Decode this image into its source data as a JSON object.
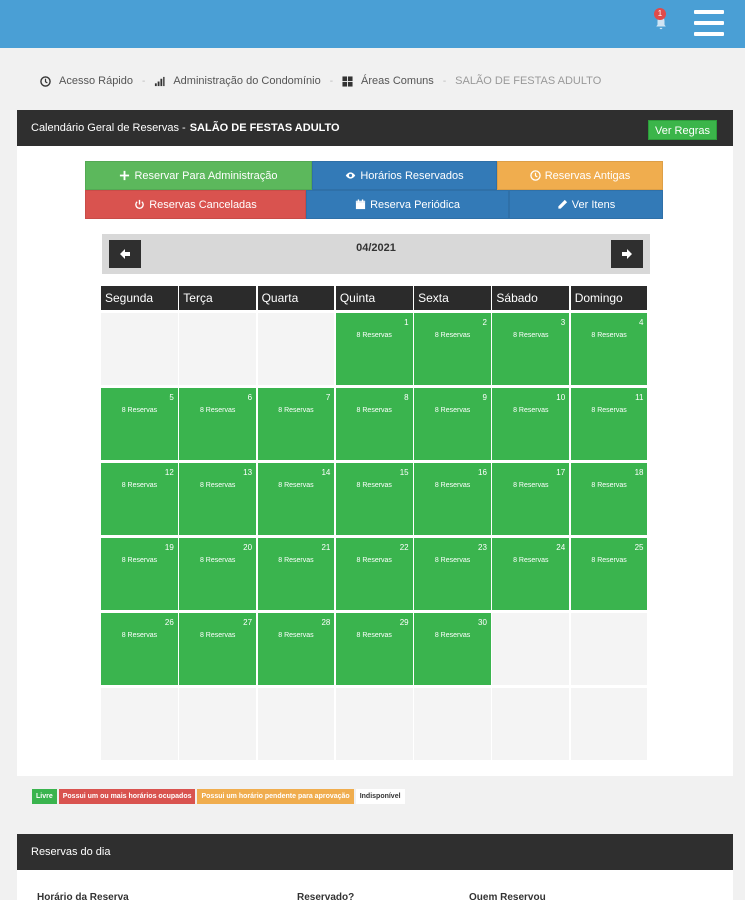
{
  "header": {
    "notification_count": "1",
    "bar_color": "#4a9fd5"
  },
  "breadcrumb": [
    {
      "icon": "clock-icon",
      "label": "Acesso Rápido"
    },
    {
      "icon": "chart-icon",
      "label": "Administração do Condomínio"
    },
    {
      "icon": "grid-icon",
      "label": "Áreas Comuns"
    },
    {
      "label": "SALÃO DE FESTAS ADULTO"
    }
  ],
  "panel": {
    "title_prefix": "Calendário Geral de Reservas -",
    "title_bold": "SALÃO DE FESTAS ADULTO",
    "rules_button": "Ver Regras"
  },
  "actions": {
    "reserve_admin": "Reservar Para Administração",
    "reserved_times": "Horários Reservados",
    "old_reservations": "Reservas Antigas",
    "cancelled": "Reservas Canceladas",
    "periodic": "Reserva Periódica",
    "view_items": "Ver Itens"
  },
  "calendar": {
    "month": "04/2021",
    "weekdays": [
      "Segunda",
      "Terça",
      "Quarta",
      "Quinta",
      "Sexta",
      "Sábado",
      "Domingo"
    ],
    "reservation_label": "8 Reservas",
    "weeks": [
      [
        "",
        "",
        "",
        "1",
        "2",
        "3",
        "4"
      ],
      [
        "5",
        "6",
        "7",
        "8",
        "9",
        "10",
        "11"
      ],
      [
        "12",
        "13",
        "14",
        "15",
        "16",
        "17",
        "18"
      ],
      [
        "19",
        "20",
        "21",
        "22",
        "23",
        "24",
        "25"
      ],
      [
        "26",
        "27",
        "28",
        "29",
        "30",
        "",
        ""
      ],
      [
        "",
        "",
        "",
        "",
        "",
        "",
        ""
      ]
    ],
    "available_color": "#3ab44e"
  },
  "legend": {
    "free": "Livre",
    "occupied": "Possui um ou mais horários ocupados",
    "pending": "Possui um horário pendente para aprovação",
    "unavailable": "Indisponível"
  },
  "day_panel": {
    "title": "Reservas do dia",
    "col_time": "Horário da Reserva",
    "col_reserved": "Reservado?",
    "col_who": "Quem Reservou"
  }
}
